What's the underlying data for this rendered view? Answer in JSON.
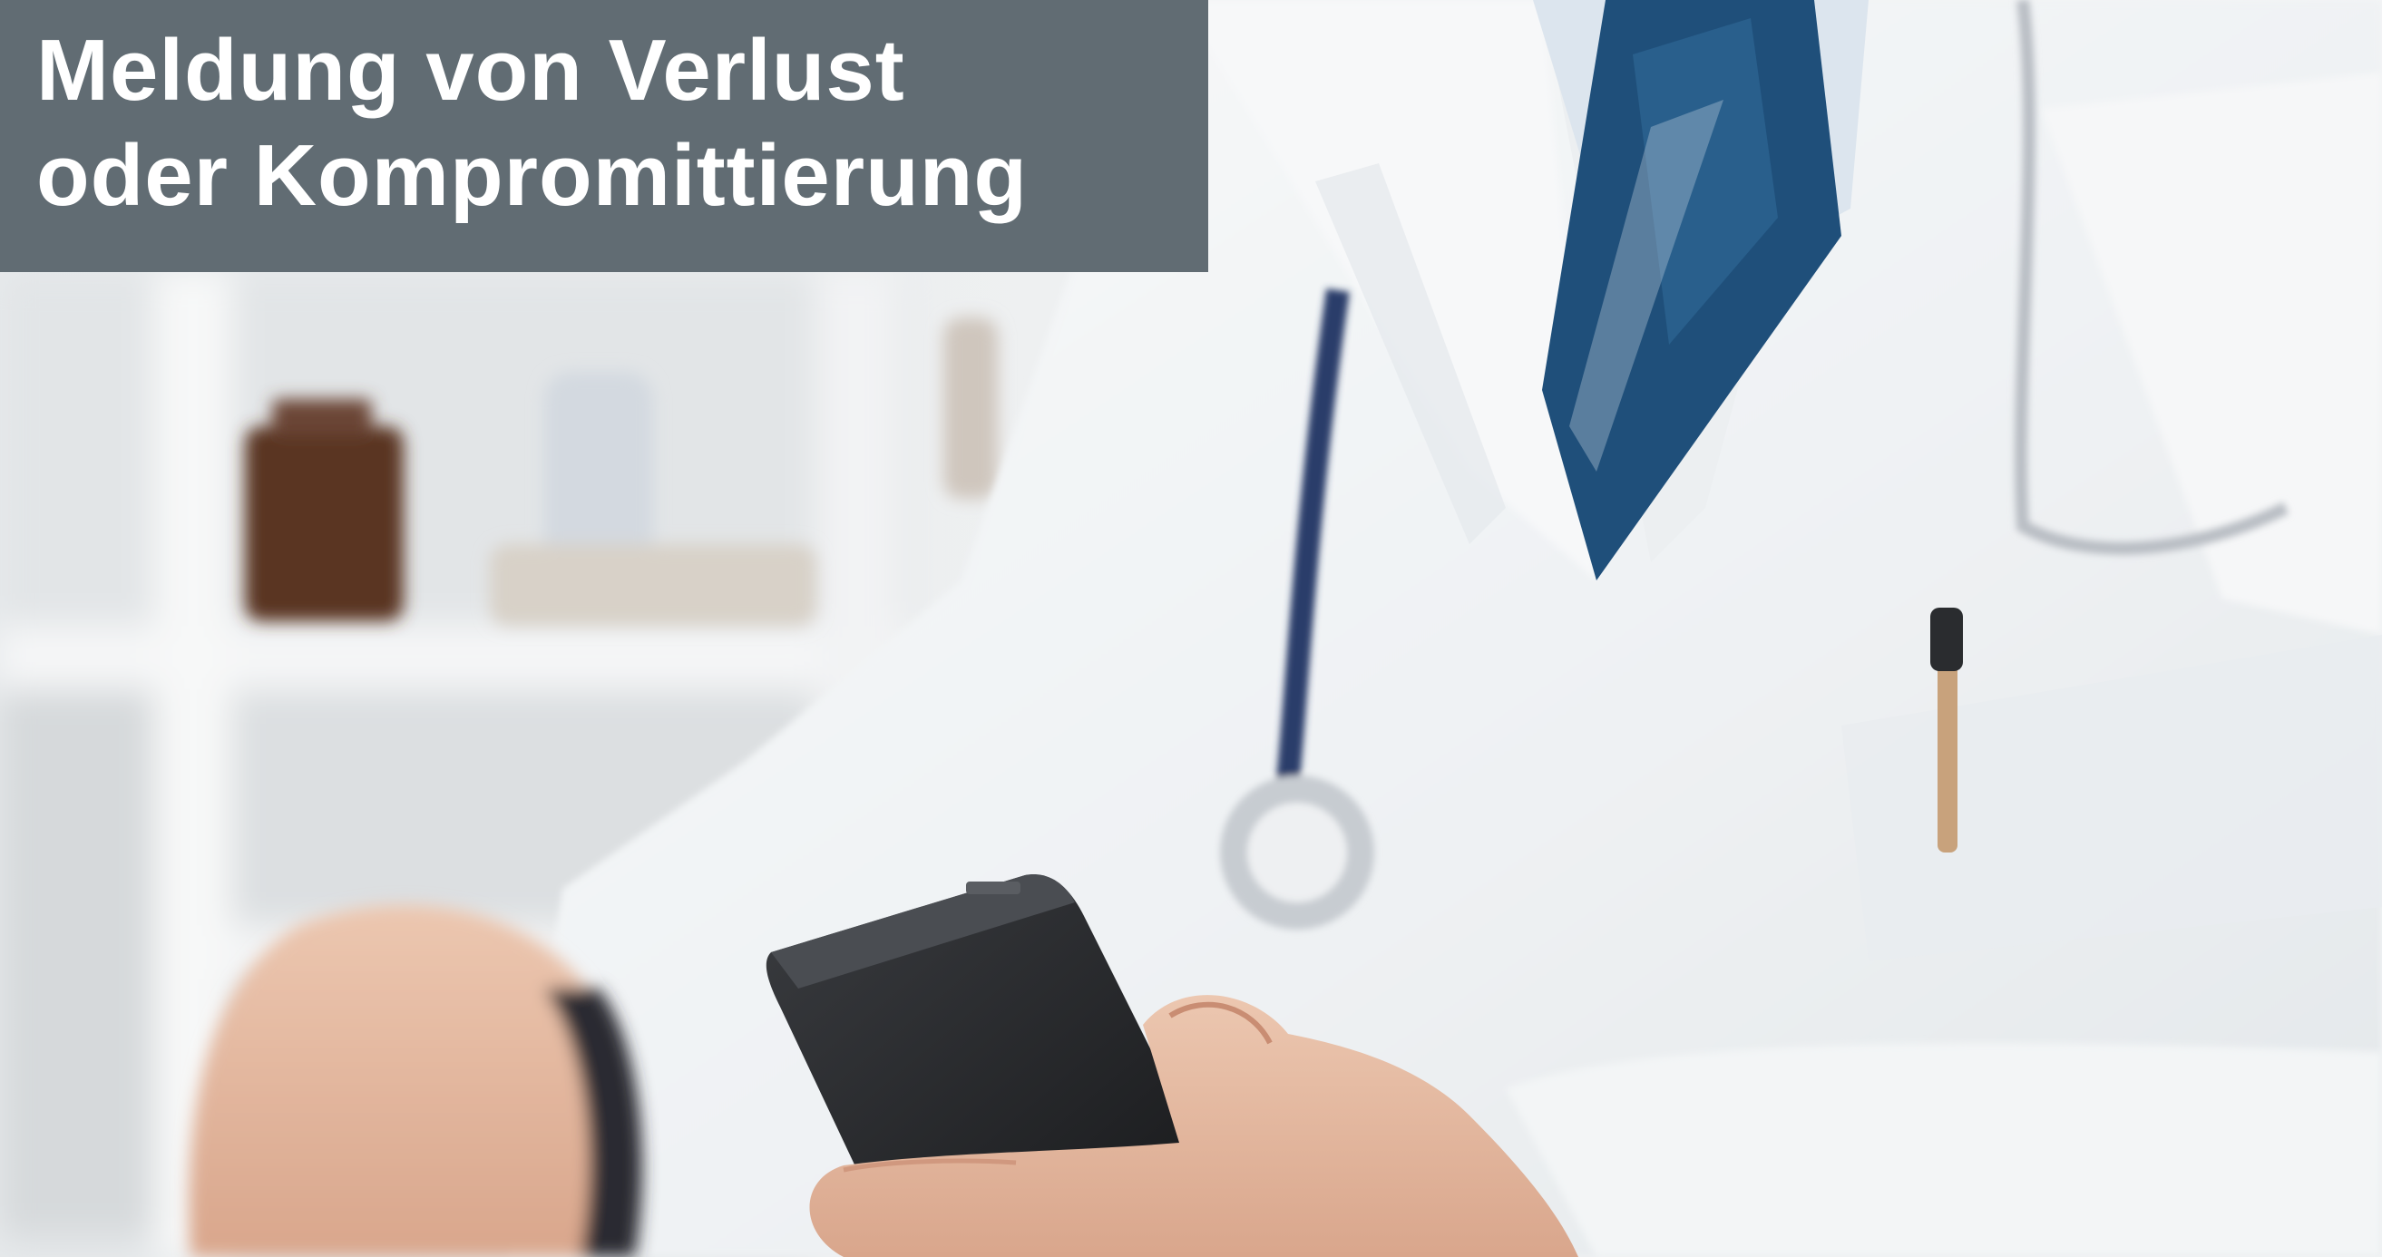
{
  "banner": {
    "title_line1": "Meldung von Verlust",
    "title_line2": "oder Kompromittierung",
    "background_color": "#616c73",
    "text_color": "#ffffff"
  },
  "photo": {
    "subject": "doctor in white coat holding a cordless phone handset",
    "dominant_colors": [
      "#f2f4f5",
      "#1f4f7a",
      "#2b2d30",
      "#e3b9a2"
    ]
  }
}
